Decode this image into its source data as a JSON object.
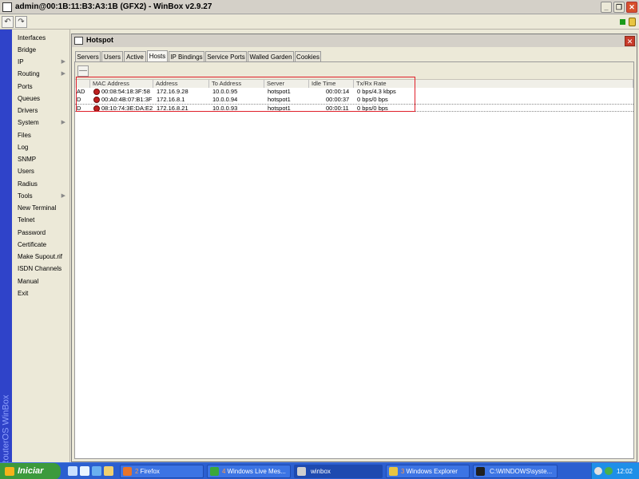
{
  "window": {
    "title": "admin@00:1B:11:B3:A3:1B (GFX2) - WinBox v2.9.27",
    "buttons": {
      "minimize": "_",
      "restore": "❐",
      "close": "✕"
    }
  },
  "toolbar": {
    "undo": "↶",
    "redo": "↷"
  },
  "sidebar": {
    "brand": "RouterOS WinBox",
    "items": [
      {
        "label": "Interfaces",
        "arrow": ""
      },
      {
        "label": "Bridge",
        "arrow": ""
      },
      {
        "label": "IP",
        "arrow": "▶"
      },
      {
        "label": "Routing",
        "arrow": "▶"
      },
      {
        "label": "Ports",
        "arrow": ""
      },
      {
        "label": "Queues",
        "arrow": ""
      },
      {
        "label": "Drivers",
        "arrow": ""
      },
      {
        "label": "System",
        "arrow": "▶"
      },
      {
        "label": "Files",
        "arrow": ""
      },
      {
        "label": "Log",
        "arrow": ""
      },
      {
        "label": "SNMP",
        "arrow": ""
      },
      {
        "label": "Users",
        "arrow": ""
      },
      {
        "label": "Radius",
        "arrow": ""
      },
      {
        "label": "Tools",
        "arrow": "▶"
      },
      {
        "label": "New Terminal",
        "arrow": ""
      },
      {
        "label": "Telnet",
        "arrow": ""
      },
      {
        "label": "Password",
        "arrow": ""
      },
      {
        "label": "Certificate",
        "arrow": ""
      },
      {
        "label": "Make Supout.rif",
        "arrow": ""
      },
      {
        "label": "ISDN Channels",
        "arrow": ""
      },
      {
        "label": "Manual",
        "arrow": ""
      },
      {
        "label": "Exit",
        "arrow": ""
      }
    ]
  },
  "hotspot": {
    "title": "Hotspot",
    "close": "✕",
    "tabs": [
      "Servers",
      "Users",
      "Active",
      "Hosts",
      "IP Bindings",
      "Service Ports",
      "Walled Garden",
      "Cookies"
    ],
    "active_tab": "Hosts",
    "remove_btn": "—",
    "columns": [
      "MAC Address",
      "Address",
      "To Address",
      "Server",
      "Idle Time",
      "Tx/Rx Rate"
    ],
    "rows": [
      {
        "flag": "AD",
        "mac": "00:08:54:18:3F:58",
        "address": "172.16.9.28",
        "to_address": "10.0.0.95",
        "server": "hotspot1",
        "idle": "00:00:14",
        "rate": "0 bps/4.3 kbps"
      },
      {
        "flag": "D",
        "mac": "00:A0:4B:07:B1:3F",
        "address": "172.16.8.1",
        "to_address": "10.0.0.94",
        "server": "hotspot1",
        "idle": "00:00:37",
        "rate": "0 bps/0 bps"
      },
      {
        "flag": "D",
        "mac": "08:10:74:3E:DA:E2",
        "address": "172.16.8.21",
        "to_address": "10.0.0.93",
        "server": "hotspot1",
        "idle": "00:00:11",
        "rate": "0 bps/0 bps"
      }
    ]
  },
  "taskbar": {
    "start": "Iniciar",
    "tasks": [
      {
        "num": "2",
        "label": "Firefox",
        "color": "#e8742a"
      },
      {
        "num": "4",
        "label": "Windows Live Mes...",
        "color": "#3aa83a"
      },
      {
        "num": "",
        "label": "winbox",
        "color": "#cfcfcf"
      },
      {
        "num": "3",
        "label": "Windows Explorer",
        "color": "#e8c542"
      },
      {
        "num": "",
        "label": "C:\\WINDOWS\\syste...",
        "color": "#202020"
      }
    ],
    "clock": "12:02"
  }
}
